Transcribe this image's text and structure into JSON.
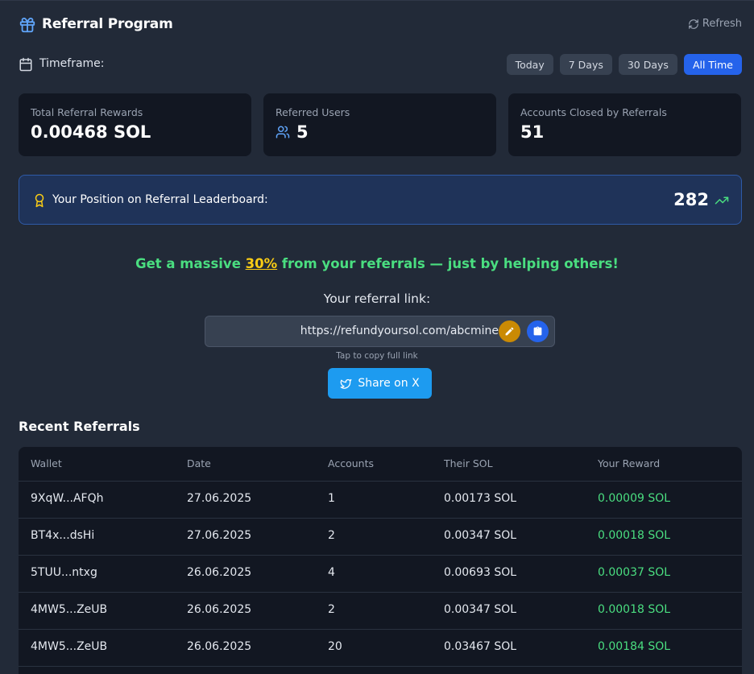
{
  "header": {
    "title": "Referral Program",
    "refresh_label": "Refresh"
  },
  "timeframe": {
    "label": "Timeframe:",
    "options": [
      "Today",
      "7 Days",
      "30 Days",
      "All Time"
    ],
    "selected": "All Time"
  },
  "stats": {
    "total_rewards": {
      "label": "Total Referral Rewards",
      "value": "0.00468 SOL"
    },
    "referred_users": {
      "label": "Referred Users",
      "value": "5"
    },
    "accounts_closed": {
      "label": "Accounts Closed by Referrals",
      "value": "51"
    }
  },
  "leaderboard": {
    "label": "Your Position on Referral Leaderboard:",
    "position": "282"
  },
  "promo": {
    "before": "Get a massive ",
    "percent": "30%",
    "after": " from your referrals — just by helping others!"
  },
  "referral": {
    "label": "Your referral link:",
    "url": "https://refundyoursol.com/abcmine",
    "hint": "Tap to copy full link",
    "share_label": "Share on X"
  },
  "recent": {
    "title": "Recent Referrals",
    "columns": [
      "Wallet",
      "Date",
      "Accounts",
      "Their SOL",
      "Your Reward"
    ],
    "rows": [
      [
        "9XqW...AFQh",
        "27.06.2025",
        "1",
        "0.00173 SOL",
        "0.00009 SOL"
      ],
      [
        "BT4x...dsHi",
        "27.06.2025",
        "2",
        "0.00347 SOL",
        "0.00018 SOL"
      ],
      [
        "5TUU...ntxg",
        "26.06.2025",
        "4",
        "0.00693 SOL",
        "0.00037 SOL"
      ],
      [
        "4MW5...ZeUB",
        "26.06.2025",
        "2",
        "0.00347 SOL",
        "0.00018 SOL"
      ],
      [
        "4MW5...ZeUB",
        "26.06.2025",
        "20",
        "0.03467 SOL",
        "0.00184 SOL"
      ]
    ]
  },
  "colors": {
    "accent": "#2563eb",
    "positive": "#4ade80",
    "highlight": "#facc15",
    "twitter": "#1d9bf0"
  }
}
